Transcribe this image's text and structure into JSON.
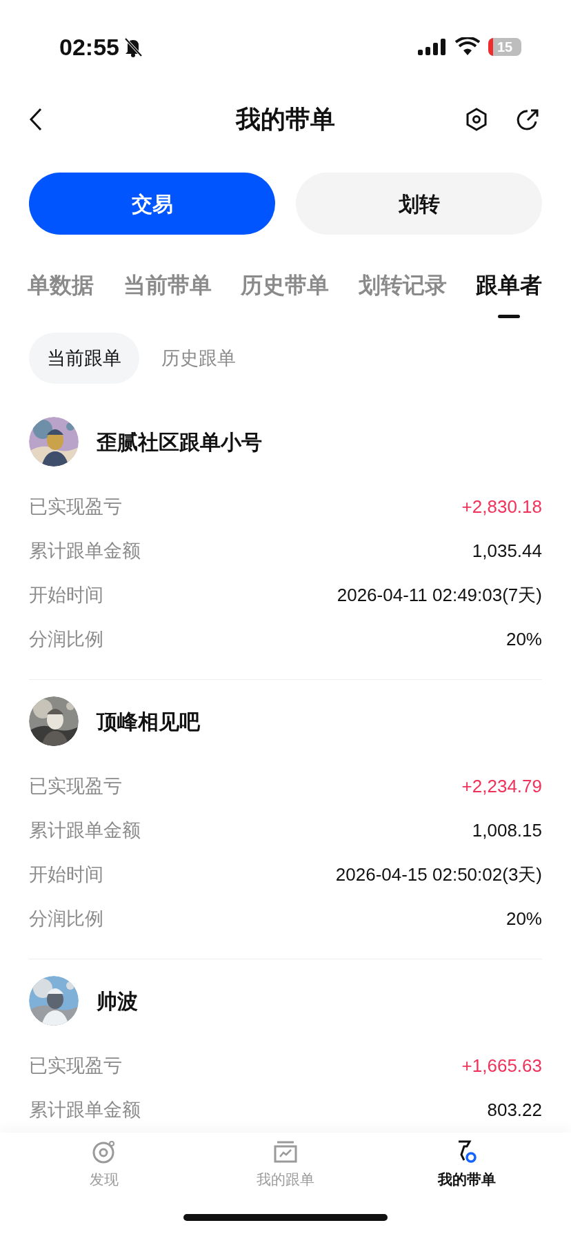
{
  "status_bar": {
    "time": "02:55",
    "battery": "15"
  },
  "header": {
    "title": "我的带单"
  },
  "actions": [
    {
      "label": "交易",
      "kind": "primary"
    },
    {
      "label": "划转",
      "kind": "secondary"
    }
  ],
  "tabs": [
    {
      "label": "单数据",
      "selected": false
    },
    {
      "label": "当前带单",
      "selected": false
    },
    {
      "label": "历史带单",
      "selected": false
    },
    {
      "label": "划转记录",
      "selected": false
    },
    {
      "label": "跟单者",
      "selected": true
    }
  ],
  "sub_tabs": [
    {
      "label": "当前跟单",
      "selected": true
    },
    {
      "label": "历史跟单",
      "selected": false
    }
  ],
  "followers": [
    {
      "name": "歪腻社区跟单小号",
      "rows": [
        {
          "label": "已实现盈亏",
          "value": "+2,830.18",
          "kind": "profit"
        },
        {
          "label": "累计跟单金额",
          "value": "1,035.44",
          "kind": "plain"
        },
        {
          "label": "开始时间",
          "value": "2026-04-11 02:49:03(7天)",
          "kind": "plain"
        },
        {
          "label": "分润比例",
          "value": "20%",
          "kind": "plain"
        }
      ]
    },
    {
      "name": "顶峰相见吧",
      "rows": [
        {
          "label": "已实现盈亏",
          "value": "+2,234.79",
          "kind": "profit"
        },
        {
          "label": "累计跟单金额",
          "value": "1,008.15",
          "kind": "plain"
        },
        {
          "label": "开始时间",
          "value": "2026-04-15 02:50:02(3天)",
          "kind": "plain"
        },
        {
          "label": "分润比例",
          "value": "20%",
          "kind": "plain"
        }
      ]
    },
    {
      "name": "帅波",
      "rows": [
        {
          "label": "已实现盈亏",
          "value": "+1,665.63",
          "kind": "profit"
        },
        {
          "label": "累计跟单金额",
          "value": "803.22",
          "kind": "plain"
        }
      ]
    }
  ],
  "bottom_nav": [
    {
      "label": "发现",
      "kind": "discover",
      "selected": false
    },
    {
      "label": "我的跟单",
      "kind": "follow",
      "selected": false
    },
    {
      "label": "我的带单",
      "kind": "lead",
      "selected": true
    }
  ]
}
